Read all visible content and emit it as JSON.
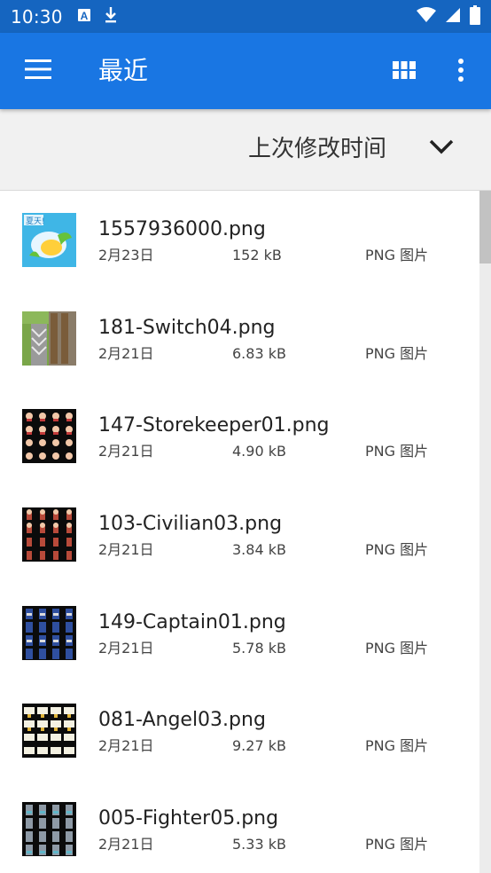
{
  "status_bar": {
    "time": "10:30",
    "left_icons": [
      "text-a-icon",
      "download-icon"
    ],
    "right_icons": [
      "wifi-icon",
      "signal-icon",
      "battery-icon"
    ]
  },
  "app_bar": {
    "title": "最近",
    "menu_icon": "hamburger-menu-icon",
    "grid_icon": "grid-view-icon",
    "more_icon": "more-vert-icon",
    "color": "#1976e3"
  },
  "sort_bar": {
    "label": "上次修改时间",
    "chevron_icon": "chevron-down-icon"
  },
  "files": [
    {
      "name": "1557936000.png",
      "date": "2月23日",
      "size": "152 kB",
      "type": "PNG 图片",
      "thumb": "summer-image"
    },
    {
      "name": "181-Switch04.png",
      "date": "2月21日",
      "size": "6.83 kB",
      "type": "PNG 图片",
      "thumb": "switch-tiles"
    },
    {
      "name": "147-Storekeeper01.png",
      "date": "2月21日",
      "size": "4.90 kB",
      "type": "PNG 图片",
      "thumb": "sprite-sheet"
    },
    {
      "name": "103-Civilian03.png",
      "date": "2月21日",
      "size": "3.84 kB",
      "type": "PNG 图片",
      "thumb": "sprite-sheet"
    },
    {
      "name": "149-Captain01.png",
      "date": "2月21日",
      "size": "5.78 kB",
      "type": "PNG 图片",
      "thumb": "sprite-sheet"
    },
    {
      "name": "081-Angel03.png",
      "date": "2月21日",
      "size": "9.27 kB",
      "type": "PNG 图片",
      "thumb": "sprite-sheet"
    },
    {
      "name": "005-Fighter05.png",
      "date": "2月21日",
      "size": "5.33 kB",
      "type": "PNG 图片",
      "thumb": "sprite-sheet"
    }
  ]
}
